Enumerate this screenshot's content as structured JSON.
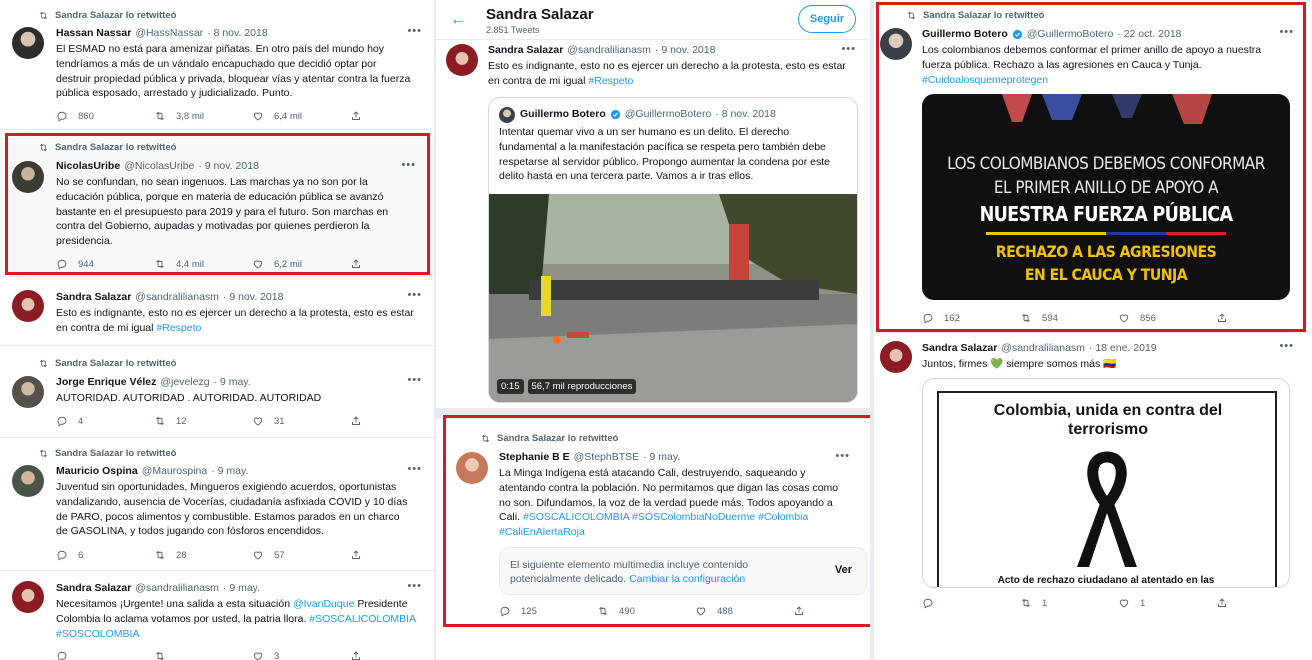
{
  "retweeted_label": "Sandra Salazar lo retwitteó",
  "col1": {
    "t1": {
      "name": "Hassan Nassar",
      "handle": "@HassNassar",
      "date": "· 8 nov. 2018",
      "text": "El ESMAD no está para amenizar piñatas. En otro país del mundo hoy tendríamos a más de un vándalo encapuchado que decidió optar por destruir propiedad pública y privada, bloquear vías y atentar contra la fuerza pública esposado, arrestado y judicializado. Punto.",
      "replies": "860",
      "retweets": "3,8 mil",
      "likes": "6,4 mil"
    },
    "t2": {
      "name": "NicolasUribe",
      "handle": "@NicolasUribe",
      "date": "· 9 nov. 2018",
      "text": "No se confundan, no sean ingenuos. Las marchas ya no son por la educación pública, porque en materia de educación pública se avanzó bastante en el presupuesto para 2019 y para el futuro. Son marchas en contra del Gobierno, aupadas y motivadas por quienes perdieron la presidencia.",
      "replies": "944",
      "retweets": "4,4 mil",
      "likes": "6,2 mil"
    },
    "t3": {
      "name": "Sandra Salazar",
      "handle": "@sandralilianasm",
      "date": "· 9 nov. 2018",
      "text": "Esto es indignante, esto no es ejercer un derecho a la protesta, esto es estar en contra de mi igual ",
      "tag": "#Respeto"
    },
    "t4": {
      "name": "Jorge Enrique Vélez",
      "handle": "@jevelezg",
      "date": "· 9 may.",
      "text": "AUTORIDAD. AUTORIDAD . AUTORIDAD. AUTORIDAD",
      "replies": "4",
      "retweets": "12",
      "likes": "31"
    },
    "t5": {
      "name": "Mauricio Ospina",
      "handle": "@Maurospina",
      "date": "· 9 may.",
      "text": "Juventud sin oportunidades, Mingueros exigiendo acuerdos, oportunistas vandalizando, ausencia de Vocerías, ciudadanía asfixiada  COVID y 10 días de PARO, pocos alimentos y combustible. Estamos parados en un charco de GASOLINA, y todos jugando con fósforos encendidos.",
      "replies": "6",
      "retweets": "28",
      "likes": "57"
    },
    "t6": {
      "name": "Sandra Salazar",
      "handle": "@sandralilianasm",
      "date": "· 9 may.",
      "text1": "Necesitamos ¡Urgente! una salida a esta situación ",
      "mention": "@IvanDuque",
      "text2": " Presidente Colombia lo aclama votamos por usted, la patria llora. ",
      "tags": "#SOSCALICOLOMBIA #SOSCOLOMBIA",
      "likes": "3"
    }
  },
  "col2": {
    "header": {
      "title": "Sandra Salazar",
      "count": "2.851 Tweets",
      "follow": "Seguir"
    },
    "t1": {
      "name": "Sandra Salazar",
      "handle": "@sandralilianasm",
      "date": "· 9 nov. 2018",
      "text": "Esto es indignante, esto no es ejercer un derecho a la protesta, esto es estar en contra de mi igual ",
      "tag": "#Respeto"
    },
    "quote": {
      "name": "Guillermo Botero",
      "handle": "@GuillermoBotero",
      "date": "· 8 nov. 2018",
      "text": "Intentar quemar vivo a un ser humano es un delito. El derecho fundamental a la manifestación pacífica se respeta pero también debe respetarse al servidor público. Propongo aumentar la condena por este delito hasta en una tercera parte. Vamos a ir tras ellos.",
      "video_time": "0:15",
      "views": "56,7 mil reproducciones"
    },
    "t2": {
      "name": "Stephanie B E",
      "handle": "@StephBTSE",
      "date": "· 9 may.",
      "text": "La Minga Indígena está atacando Cali, destruyendo, saqueando y atentando contra la población. No permitamos que digan las cosas como no son. Difundamos, la voz de la verdad puede más. Todos apoyando a Cali.",
      "tags1": "#SOSCALICOLOMBIA #SOSColombiaNoDuerme #Colombia",
      "tags2": "#CaliEnAlertaRoja",
      "sens_text": "El siguiente elemento multimedia incluye contenido potencialmente delicado. ",
      "sens_link": "Cambiar la configuración",
      "sens_btn": "Ver",
      "replies": "125",
      "retweets": "490",
      "likes": "488"
    }
  },
  "col3": {
    "t1": {
      "name": "Guillermo Botero",
      "handle": "@GuillermoBotero",
      "date": "· 22 oct. 2018",
      "text": "Los colombianos debemos conformar el primer anillo de apoyo a nuestra fuerza pública. Rechazo a las agresiones en Cauca y Tunja.",
      "tag": "#Cuidoalosquemeprotegen",
      "img_l1": "LOS COLOMBIANOS DEBEMOS CONFORMAR",
      "img_l2": "EL PRIMER ANILLO DE APOYO A",
      "img_l3": "NUESTRA FUERZA PÚBLICA",
      "img_l4": "RECHAZO A LAS AGRESIONES",
      "img_l5": "EN EL CAUCA Y TUNJA",
      "replies": "162",
      "retweets": "594",
      "likes": "856"
    },
    "t2": {
      "name": "Sandra Salazar",
      "handle": "@sandralilianasm",
      "date": "· 18 ene. 2019",
      "text": "Juntos, firmes 💚 siempre somos más 🇨🇴",
      "img_title": "Colombia, unida en contra del terrorismo",
      "img_caption": "Acto de rechazo ciudadano al atentado en las",
      "retweets": "1",
      "likes": "1"
    }
  },
  "colors": {
    "accent": "#1d9bf0",
    "highlight": "#d71920"
  }
}
